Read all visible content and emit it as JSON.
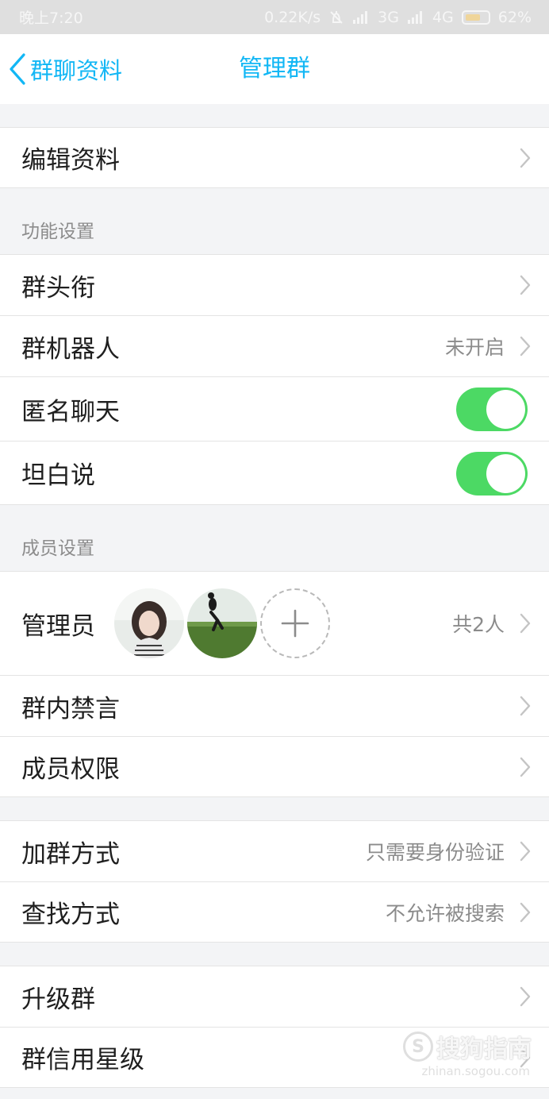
{
  "status_bar": {
    "time": "晚上7:20",
    "speed": "0.22K/s",
    "network_3g": "3G",
    "network_4g": "4G",
    "battery": "62%"
  },
  "nav": {
    "back_label": "群聊资料",
    "title": "管理群"
  },
  "edit_info": {
    "label": "编辑资料"
  },
  "function_settings": {
    "header": "功能设置",
    "group_title": {
      "label": "群头衔"
    },
    "group_robot": {
      "label": "群机器人",
      "value": "未开启"
    },
    "anonymous_chat": {
      "label": "匿名聊天",
      "enabled": true
    },
    "tanbaishuo": {
      "label": "坦白说",
      "enabled": true
    }
  },
  "member_settings": {
    "header": "成员设置",
    "admins": {
      "label": "管理员",
      "count": "共2人"
    },
    "mute": {
      "label": "群内禁言"
    },
    "permissions": {
      "label": "成员权限"
    }
  },
  "join_settings": {
    "join_method": {
      "label": "加群方式",
      "value": "只需要身份验证"
    },
    "search_method": {
      "label": "查找方式",
      "value": "不允许被搜索"
    }
  },
  "upgrade": {
    "upgrade_group": {
      "label": "升级群"
    },
    "credit_level": {
      "label": "群信用星级"
    }
  },
  "watermark": {
    "logo": "S",
    "text": "搜狗指南",
    "url": "zhinan.sogou.com"
  },
  "colors": {
    "accent": "#12b7f5",
    "toggle_on": "#4cd964"
  }
}
